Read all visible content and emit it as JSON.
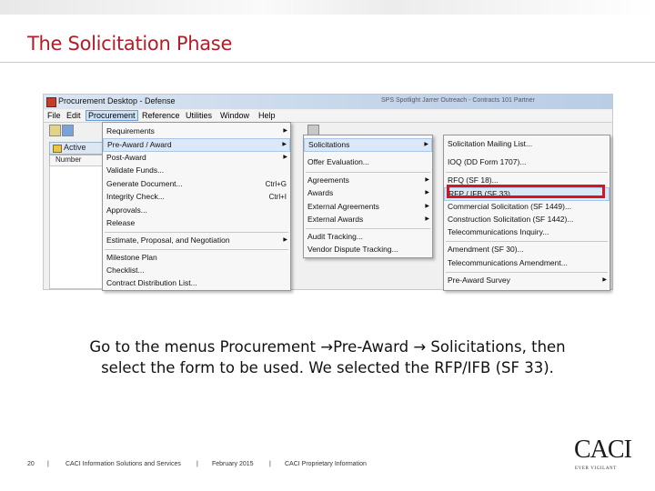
{
  "slide": {
    "title": "The Solicitation Phase",
    "caption_line1": "Go to the menus Procurement →Pre-Award → Solicitations, then",
    "caption_line2": "select the form to be used.  We selected the RFP/IFB (SF 33).",
    "footer": {
      "page_number": "20",
      "sep": "|",
      "company": "CACI Information Solutions and Services",
      "date": "February 2015",
      "classification": "CACI Proprietary Information"
    },
    "logo": {
      "text": "CACI",
      "tagline": "EVER VIGILANT"
    }
  },
  "app": {
    "window_title": "Procurement Desktop - Defense",
    "window_title_right": "SPS Spotlight Jarrer Outreach - Contracts 101 Partner",
    "menubar": [
      "File",
      "Edit",
      "Procurement",
      "Reference",
      "Utilities",
      "Window",
      "Help"
    ],
    "active_menu": "Procurement",
    "child_tab": "Active",
    "grid_column": "Number"
  },
  "procurement_menu": [
    {
      "label": "Requirements",
      "arrow": "▶"
    },
    {
      "label": "Pre-Award / Award",
      "arrow": "▶"
    },
    {
      "label": "Post-Award",
      "arrow": "▶"
    },
    {
      "label": "Validate Funds..."
    },
    {
      "label": "Generate Document...",
      "shortcut": "Ctrl+G"
    },
    {
      "label": "Integrity Check...",
      "shortcut": "Ctrl+I"
    },
    {
      "label": "Approvals..."
    },
    {
      "label": "Release"
    },
    {
      "label": "Estimate, Proposal, and Negotiation",
      "arrow": "▶"
    },
    {
      "label": "Milestone Plan"
    },
    {
      "label": "Checklist..."
    },
    {
      "label": "Contract Distribution List..."
    }
  ],
  "preaward_menu": [
    {
      "label": "Solicitations",
      "arrow": "▶"
    },
    {
      "label": "Offer Evaluation..."
    },
    {
      "label": "Agreements",
      "arrow": "▶"
    },
    {
      "label": "Awards",
      "arrow": "▶"
    },
    {
      "label": "External Agreements",
      "arrow": "▶"
    },
    {
      "label": "External Awards",
      "arrow": "▶"
    },
    {
      "label": "Audit Tracking..."
    },
    {
      "label": "Vendor Dispute Tracking..."
    }
  ],
  "solicitations_menu": [
    {
      "label": "Solicitation Mailing List..."
    },
    {
      "label": "IOQ (DD Form 1707)..."
    },
    {
      "label": "RFQ (SF 18)..."
    },
    {
      "label": "RFP / IFB (SF 33)..."
    },
    {
      "label": "Commercial Solicitation (SF 1449)..."
    },
    {
      "label": "Construction Solicitation (SF 1442)..."
    },
    {
      "label": "Telecommunications Inquiry..."
    },
    {
      "label": "Amendment (SF 30)..."
    },
    {
      "label": "Telecommunications Amendment..."
    },
    {
      "label": "Pre-Award Survey",
      "arrow": "▶"
    }
  ],
  "selected_form": "RFP / IFB (SF 33)...",
  "colors": {
    "title_red": "#b11d29",
    "highlight_box": "#d8151f"
  }
}
